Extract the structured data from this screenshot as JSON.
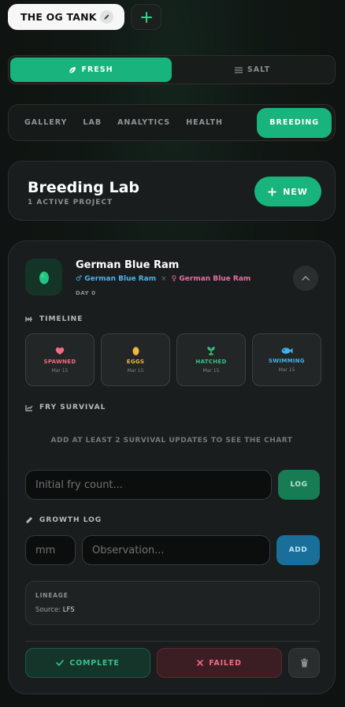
{
  "tank": {
    "name": "THE OG TANK",
    "edit_icon": "pencil-icon",
    "add_icon": "plus-icon"
  },
  "water_type": {
    "options": [
      {
        "label": "FRESH",
        "icon": "leaf-icon",
        "active": true
      },
      {
        "label": "SALT",
        "icon": "waves-icon",
        "active": false
      }
    ]
  },
  "nav": {
    "tabs": [
      {
        "label": "GALLERY",
        "active": false
      },
      {
        "label": "LAB",
        "active": false
      },
      {
        "label": "ANALYTICS",
        "active": false
      },
      {
        "label": "HEALTH",
        "active": false
      },
      {
        "label": "BREEDING",
        "active": true
      }
    ]
  },
  "header": {
    "title": "Breeding Lab",
    "subtitle": "1 ACTIVE PROJECT",
    "new_label": "NEW"
  },
  "project": {
    "species": "German Blue Ram",
    "male_symbol": "♂",
    "male": "German Blue Ram",
    "times": "×",
    "female_symbol": "♀",
    "female": "German Blue Ram",
    "day": "DAY 0",
    "timeline_label": "TIMELINE",
    "timeline": [
      {
        "label": "SPAWNED",
        "date": "Mar 15",
        "icon": "heart-icon",
        "color": "#f06b83"
      },
      {
        "label": "EGGS",
        "date": "Mar 15",
        "icon": "egg-icon",
        "color": "#f3b73a"
      },
      {
        "label": "HATCHED",
        "date": "Mar 15",
        "icon": "sprout-icon",
        "color": "#35c486"
      },
      {
        "label": "SWIMMING",
        "date": "Mar 15",
        "icon": "fish-icon",
        "color": "#42b2ee"
      }
    ],
    "survival_label": "FRY SURVIVAL",
    "survival_note": "ADD AT LEAST 2 SURVIVAL UPDATES TO SEE THE CHART",
    "fry_placeholder": "Initial fry count...",
    "log_label": "LOG",
    "growth_label": "GROWTH LOG",
    "mm_placeholder": "mm",
    "observation_placeholder": "Observation...",
    "add_label": "ADD",
    "lineage_label": "LINEAGE",
    "source_prefix": "Source:",
    "source_value": "LFS",
    "complete_label": "COMPLETE",
    "failed_label": "FAILED"
  },
  "colors": {
    "accent": "#19b37d",
    "male": "#4cb3ef",
    "female": "#ea6da8",
    "fail": "#f36b7e",
    "add": "#1a6f9a"
  }
}
